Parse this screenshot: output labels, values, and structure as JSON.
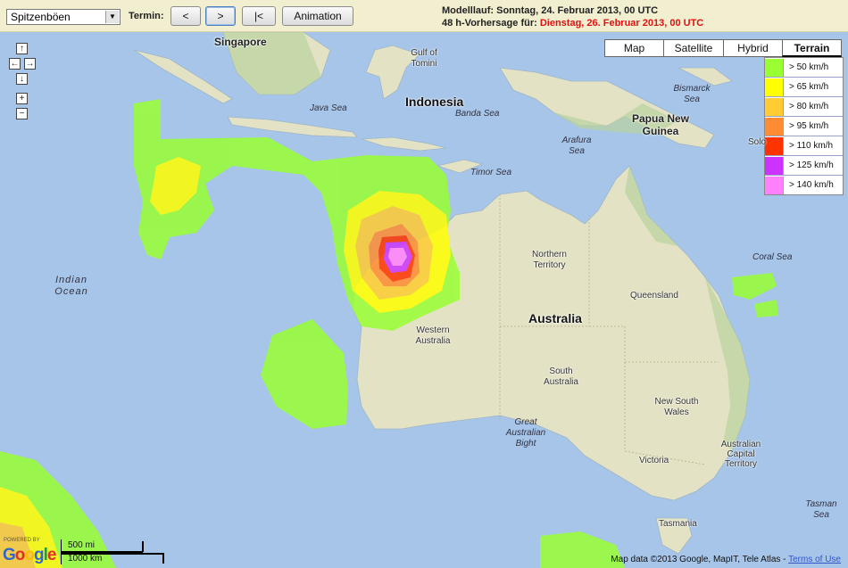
{
  "toolbar": {
    "variable_select": "Spitzenböen",
    "termin_label": "Termin:",
    "prev_label": "<",
    "next_label": ">",
    "first_label": "|<",
    "animation_label": "Animation",
    "modelrun_line": "Modelllauf: Sonntag, 24. Februar 2013, 00 UTC",
    "forecast_prefix": "48 h-Vorhersage für: ",
    "forecast_date": "Dienstag, 26. Februar 2013, 00 UTC"
  },
  "map_types": [
    "Map",
    "Satellite",
    "Hybrid",
    "Terrain"
  ],
  "selected_map_type": "Terrain",
  "legend": [
    {
      "label": "> 50 km/h",
      "color": "#99ff33"
    },
    {
      "label": "> 65 km/h",
      "color": "#ffff00"
    },
    {
      "label": "> 80 km/h",
      "color": "#ffcc33"
    },
    {
      "label": "> 95 km/h",
      "color": "#ff8c33"
    },
    {
      "label": "> 110 km/h",
      "color": "#ff3300"
    },
    {
      "label": "> 125 km/h",
      "color": "#cc33ff"
    },
    {
      "label": "> 140 km/h",
      "color": "#ff80ff"
    }
  ],
  "nav": {
    "up": "↑",
    "left": "←",
    "right": "→",
    "down": "↓",
    "zoom_in": "+",
    "zoom_out": "−"
  },
  "places": {
    "singapore": "Singapore",
    "gulf_tomini": "Gulf of Tomini",
    "indonesia": "Indonesia",
    "java_sea": "Java Sea",
    "banda_sea": "Banda Sea",
    "bismarck_sea": "Bismarck Sea",
    "png": "Papua New Guinea",
    "arafura_sea": "Arafura Sea",
    "solo": "Solo",
    "timor_sea": "Timor Sea",
    "indian_ocean": "Indian Ocean",
    "northern_territory": "Northern Territory",
    "queensland": "Queensland",
    "coral_sea": "Coral Sea",
    "australia": "Australia",
    "western_australia": "Western Australia",
    "south_australia": "South Australia",
    "nsw": "New South Wales",
    "great_australian_bight": "Great Australian Bight",
    "act": "Australian Capital Territory",
    "victoria": "Victoria",
    "tasmania": "Tasmania",
    "tasman_sea": "Tasman Sea"
  },
  "scale": {
    "miles": "500 mi",
    "km": "1000 km"
  },
  "logo": {
    "powered": "POWERED BY",
    "name": "Google"
  },
  "attribution": {
    "text": "Map data ©2013 Google, MapIT, Tele Atlas - ",
    "terms": "Terms of Use"
  },
  "colors": {
    "ocean": "#a6c5e8",
    "land": "#e3e2c4",
    "forest": "#b9d3a0",
    "gust_50": "#99ff33",
    "gust_65": "#ffff00",
    "gust_80": "#ffcc33",
    "gust_95": "#ff8c33",
    "gust_110": "#ff3300",
    "gust_125": "#cc33ff",
    "gust_140": "#ff80ff"
  }
}
